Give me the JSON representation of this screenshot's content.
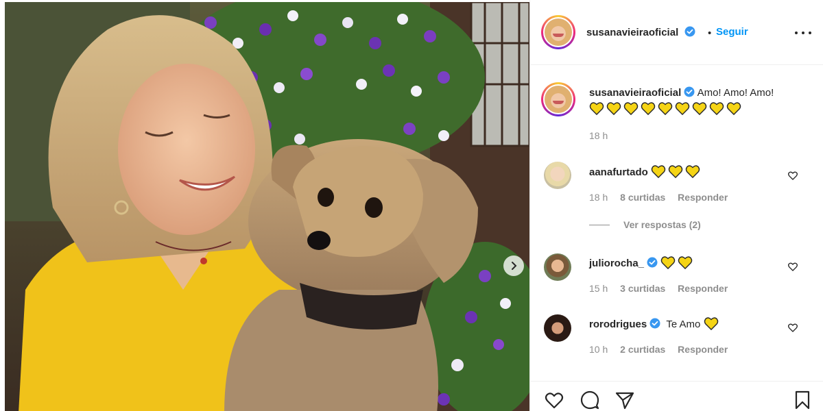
{
  "post": {
    "author": {
      "username": "susanavieiraoficial",
      "verified_icon": "verified-badge-icon"
    },
    "follow_label": "Seguir",
    "separator": "•",
    "more_icon": "more-options-icon"
  },
  "caption": {
    "username": "susanavieiraoficial",
    "text": "Amo! Amo! Amo!",
    "emoji_count": 9,
    "time": "18 h"
  },
  "comments": [
    {
      "username": "aanafurtado",
      "verified": false,
      "text": "",
      "heart_count": 3,
      "time": "18 h",
      "likes": "8 curtidas",
      "reply": "Responder",
      "view_replies": "Ver respostas (2)"
    },
    {
      "username": "juliorocha_",
      "verified": true,
      "text": "",
      "heart_count": 2,
      "time": "15 h",
      "likes": "3 curtidas",
      "reply": "Responder"
    },
    {
      "username": "rorodrigues",
      "verified": true,
      "text": "Te Amo",
      "heart_count": 1,
      "time": "10 h",
      "likes": "2 curtidas",
      "reply": "Responder"
    }
  ],
  "actions": {
    "like_icon": "heart-outline-icon",
    "comment_icon": "comment-icon",
    "share_icon": "share-icon",
    "save_icon": "bookmark-icon"
  },
  "colors": {
    "link_blue": "#0095f6",
    "verified_blue": "#3897f0",
    "muted": "#8e8e8e",
    "heart_yellow": "#f5d415"
  }
}
